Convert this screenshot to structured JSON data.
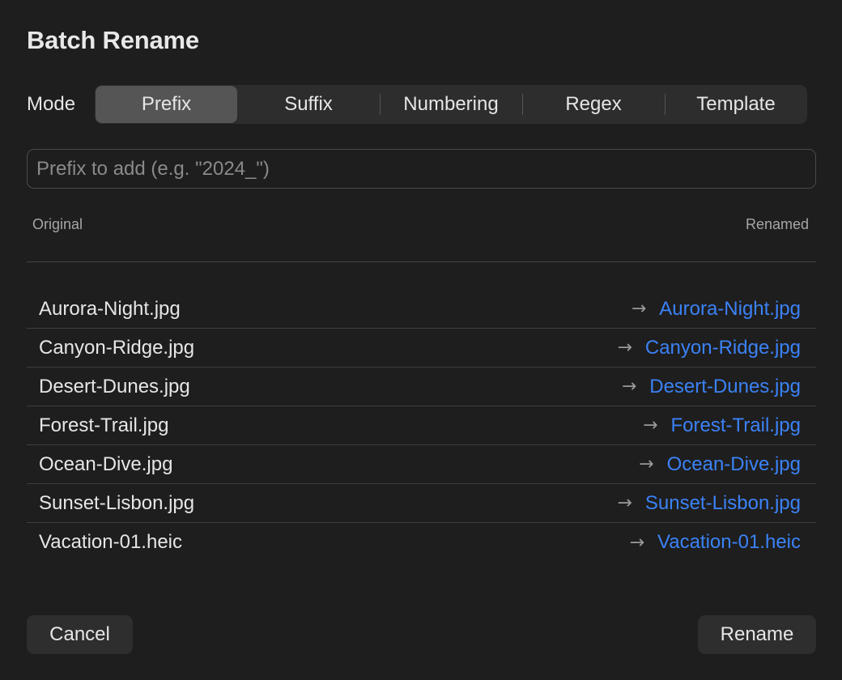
{
  "dialog": {
    "title": "Batch Rename"
  },
  "mode": {
    "label": "Mode",
    "options": [
      "Prefix",
      "Suffix",
      "Numbering",
      "Regex",
      "Template"
    ],
    "selected": "Prefix"
  },
  "input": {
    "value": "",
    "placeholder": "Prefix to add (e.g. \"2024_\")"
  },
  "columns": {
    "original": "Original",
    "renamed": "Renamed"
  },
  "files": [
    {
      "original": "Aurora-Night.jpg",
      "renamed": "Aurora-Night.jpg"
    },
    {
      "original": "Canyon-Ridge.jpg",
      "renamed": "Canyon-Ridge.jpg"
    },
    {
      "original": "Desert-Dunes.jpg",
      "renamed": "Desert-Dunes.jpg"
    },
    {
      "original": "Forest-Trail.jpg",
      "renamed": "Forest-Trail.jpg"
    },
    {
      "original": "Ocean-Dive.jpg",
      "renamed": "Ocean-Dive.jpg"
    },
    {
      "original": "Sunset-Lisbon.jpg",
      "renamed": "Sunset-Lisbon.jpg"
    },
    {
      "original": "Vacation-01.heic",
      "renamed": "Vacation-01.heic"
    }
  ],
  "arrow_glyph": "→",
  "arrow_icon": "arrow-right-icon",
  "buttons": {
    "cancel": "Cancel",
    "rename": "Rename"
  },
  "colors": {
    "background": "#1e1e1e",
    "accent": "#3b82f6",
    "segment_selected": "#555555",
    "segment_bg": "#2d2d2d"
  }
}
